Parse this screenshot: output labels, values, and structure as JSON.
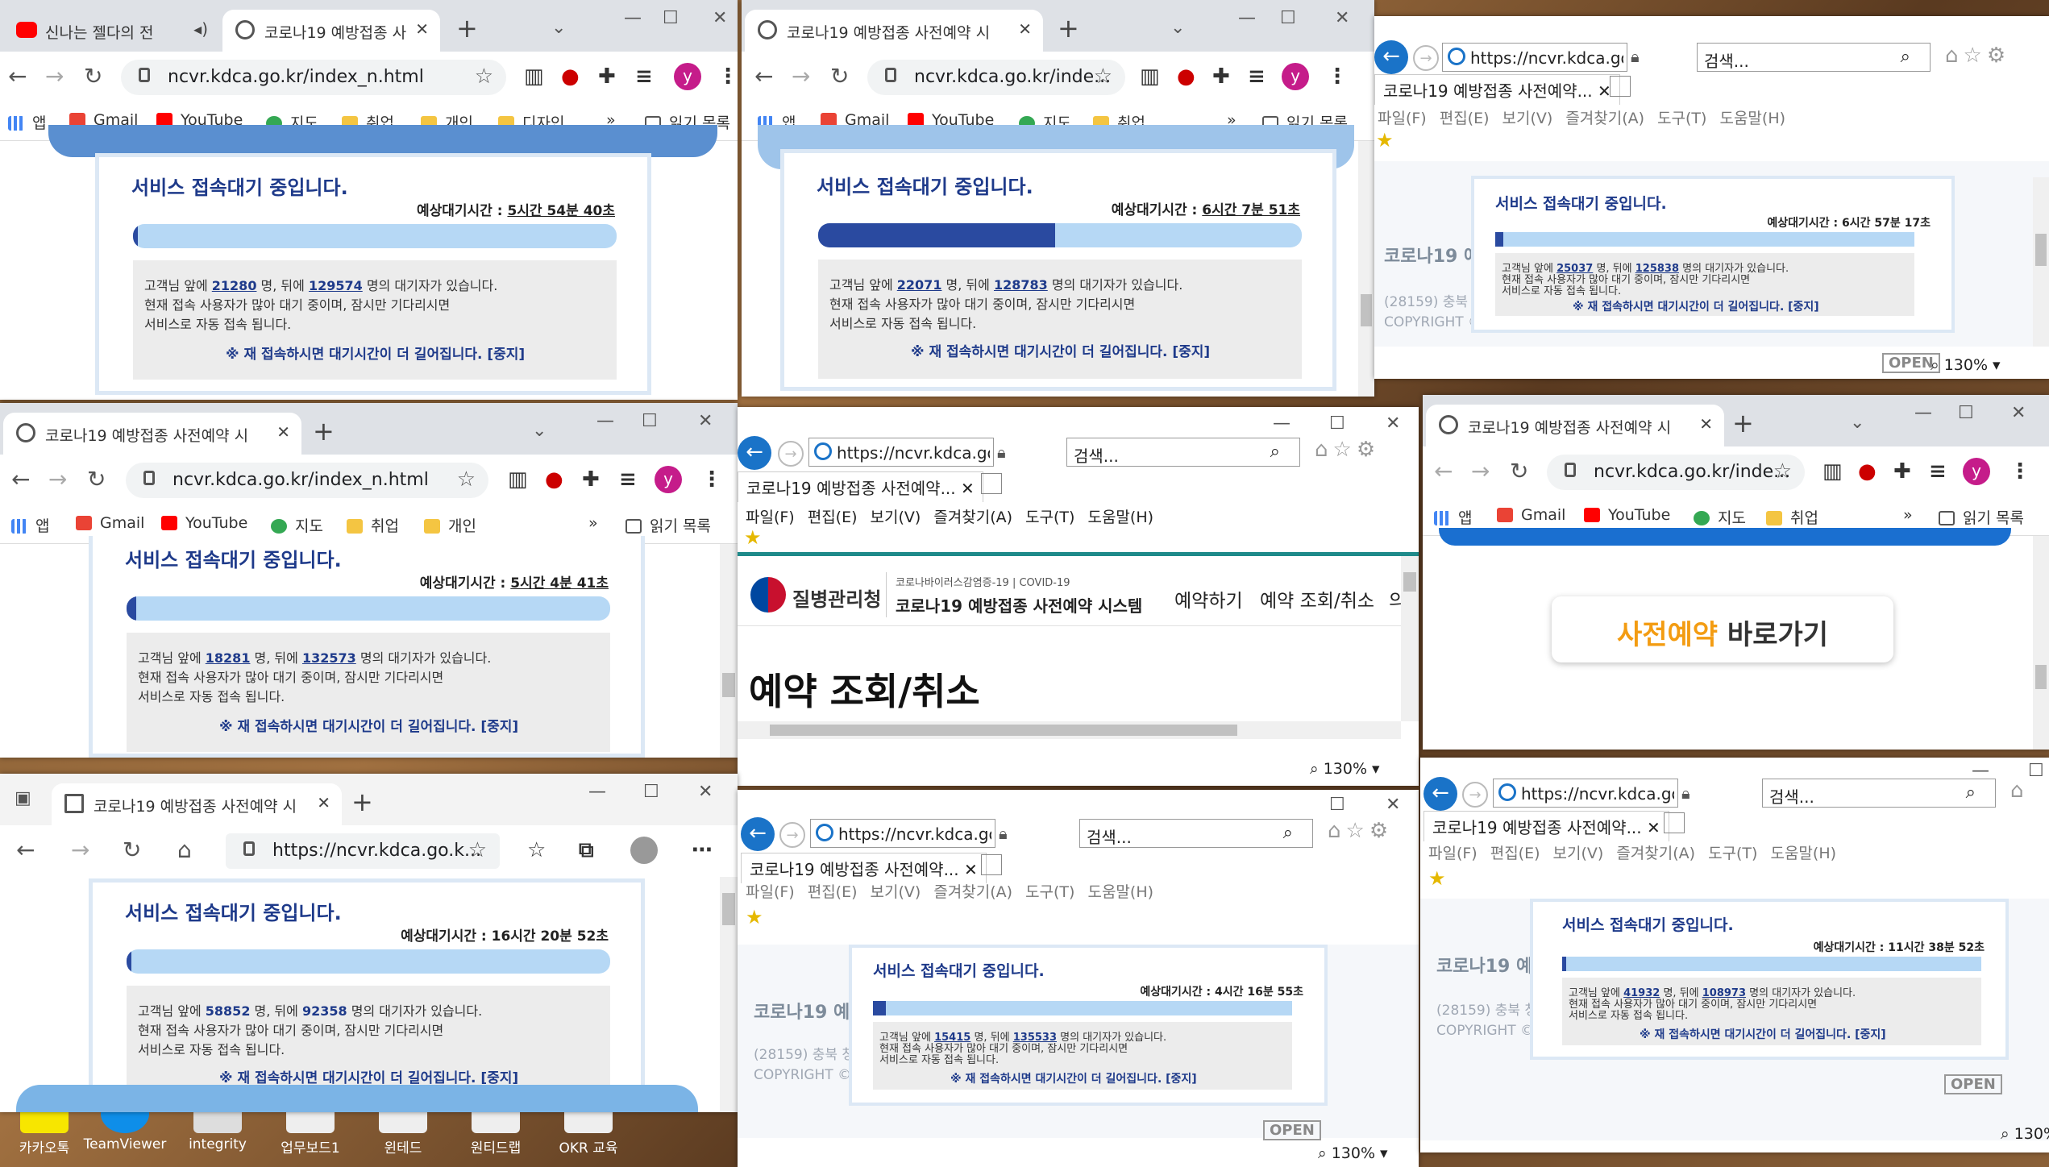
{
  "queue_common": {
    "title": "서비스 접속대기 중입니다.",
    "wait_label": "예상대기시간 : ",
    "ahead_prefix": "고객님 앞에 ",
    "ahead_mid": " 명, 뒤에 ",
    "behind_suffix": " 명의 대기자가 있습니다.",
    "line2": "현재 접속 사용자가 많아 대기 중이며, 잠시만 기다리시면",
    "line3": "서비스로 자동 접속 됩니다.",
    "warning": "※ 재 접속하시면 대기시간이 더 길어집니다. [중지]"
  },
  "chrome_common": {
    "new_tab": "+",
    "bookmarks": {
      "apps": "앱",
      "gmail": "Gmail",
      "youtube": "YouTube",
      "maps": "지도",
      "job": "취업",
      "personal": "개인",
      "design": "디자인",
      "more": "»",
      "reading_list": "읽기 목록"
    },
    "avatar_letter": "y"
  },
  "ie_common": {
    "url": "https://ncvr.kdca.go.kr/in",
    "search_placeholder": "검색...",
    "tab_title": "코로나19 예방접종 사전예약...",
    "menu": [
      "파일(F)",
      "편집(E)",
      "보기(V)",
      "즐겨찾기(A)",
      "도구(T)",
      "도움말(H)"
    ],
    "zoom": "130%",
    "site_title_partial": "코로나19 예방",
    "address_partial": "(28159) 충북 청",
    "copyright_partial": "COPYRIGHT ©",
    "open_badge": "OPEN"
  },
  "win1": {
    "tab1": "신나는 젤다의 전",
    "tab2": "코로나19 예방접종 사",
    "url": "ncvr.kdca.go.kr/index_n.html",
    "wait_time": "5시간 54분 40초",
    "ahead": "21280",
    "behind": "129574",
    "progress": 0.01
  },
  "win2": {
    "tab": "코로나19 예방접종 사전예약 시",
    "url": "ncvr.kdca.go.kr/inde...",
    "wait_time": "6시간 7분 51초",
    "ahead": "22071",
    "behind": "128783",
    "progress": 0.49
  },
  "win3": {
    "wait_time": "6시간 57분 17초",
    "ahead": "25037",
    "behind": "125838",
    "progress": 0.02
  },
  "win4": {
    "tab": "코로나19 예방접종 사전예약 시",
    "url": "ncvr.kdca.go.kr/index_n.html",
    "wait_time": "5시간 4분 41초",
    "ahead": "18281",
    "behind": "132573",
    "progress": 0.02
  },
  "win5": {
    "org": "질병관리청",
    "site_sub": "코로나바이러스감염증-19 | COVID-19",
    "site_title": "코로나19 예방접종 사전예약 시스템",
    "nav": [
      "예약하기",
      "예약 조회/취소",
      "의"
    ],
    "page_heading": "예약 조회/취소"
  },
  "win6": {
    "tab": "코로나19 예방접종 사전예약 시",
    "url": "ncvr.kdca.go.kr/inde...",
    "cta_highlight": "사전예약",
    "cta_rest": " 바로가기"
  },
  "win7": {
    "tab": "코로나19 예방접종 사전예약 시",
    "url": "https://ncvr.kdca.go.k...",
    "wait_time": "16시간 20분 52초",
    "ahead": "58852",
    "behind": "92358",
    "progress": 0.01
  },
  "win8": {
    "wait_time": "4시간 16분 55초",
    "ahead": "15415",
    "behind": "135533",
    "progress": 0.03
  },
  "win9": {
    "wait_time": "11시간 38분 52초",
    "ahead": "41932",
    "behind": "108973",
    "progress": 0.01
  },
  "taskbar": [
    "카카오톡",
    "TeamViewer",
    "integrity",
    "업무보드1",
    "윈테드",
    "원티드랩",
    "OKR 교육"
  ]
}
